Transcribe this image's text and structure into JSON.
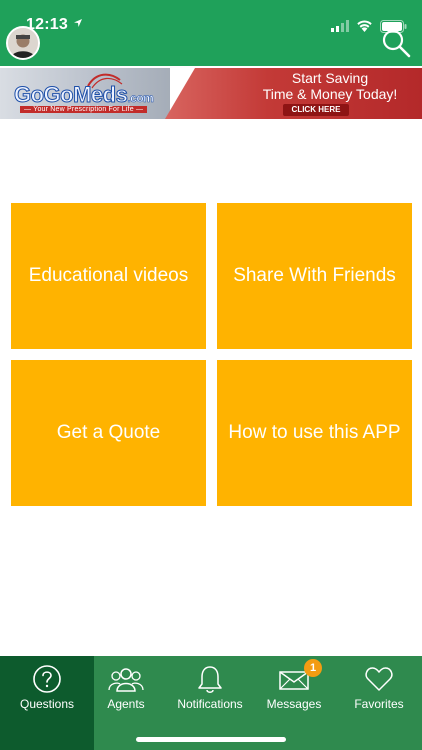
{
  "status_bar": {
    "time": "12:13"
  },
  "ad": {
    "brand_main": "GoGoMeds",
    "brand_suffix": ".com",
    "tagline": "— Your New Prescription For Life —",
    "headline_1": "Start Saving",
    "headline_2": "Time & Money Today!",
    "cta": "CLICK HERE"
  },
  "tiles": [
    {
      "label": "Educational videos"
    },
    {
      "label": "Share With Friends"
    },
    {
      "label": "Get a Quote"
    },
    {
      "label": "How to use this APP"
    }
  ],
  "tabs": [
    {
      "label": "Questions",
      "icon": "question-circle-icon",
      "active": true
    },
    {
      "label": "Agents",
      "icon": "people-icon"
    },
    {
      "label": "Notifications",
      "icon": "bell-icon"
    },
    {
      "label": "Messages",
      "icon": "envelope-icon",
      "badge": "1"
    },
    {
      "label": "Favorites",
      "icon": "heart-icon"
    }
  ],
  "colors": {
    "header": "#1fa15a",
    "tile": "#ffb300",
    "tabbar": "#2f8a4e",
    "tab_active": "#0d5b2d",
    "badge": "#f39c12"
  }
}
